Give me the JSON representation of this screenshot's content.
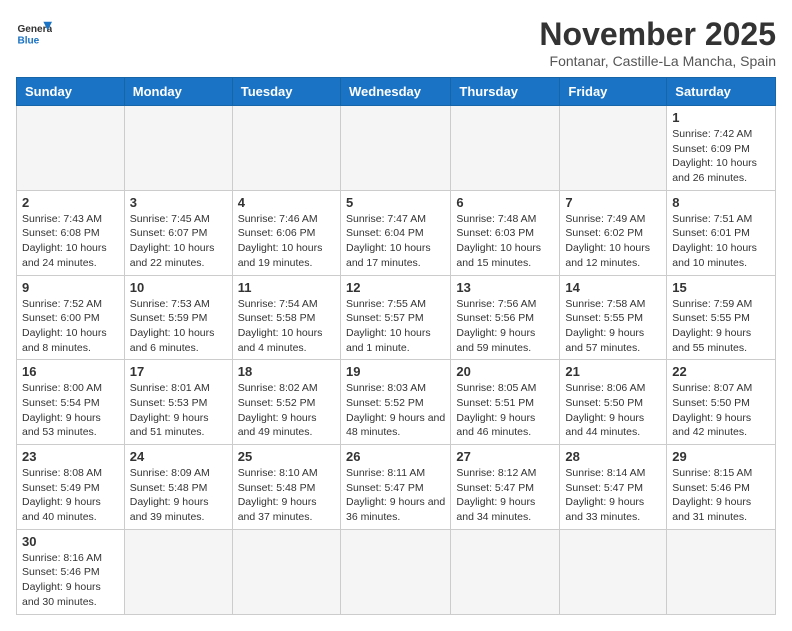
{
  "logo": {
    "text_general": "General",
    "text_blue": "Blue"
  },
  "header": {
    "month_title": "November 2025",
    "subtitle": "Fontanar, Castille-La Mancha, Spain"
  },
  "days_of_week": [
    "Sunday",
    "Monday",
    "Tuesday",
    "Wednesday",
    "Thursday",
    "Friday",
    "Saturday"
  ],
  "weeks": [
    [
      {
        "day": "",
        "info": ""
      },
      {
        "day": "",
        "info": ""
      },
      {
        "day": "",
        "info": ""
      },
      {
        "day": "",
        "info": ""
      },
      {
        "day": "",
        "info": ""
      },
      {
        "day": "",
        "info": ""
      },
      {
        "day": "1",
        "info": "Sunrise: 7:42 AM\nSunset: 6:09 PM\nDaylight: 10 hours and 26 minutes."
      }
    ],
    [
      {
        "day": "2",
        "info": "Sunrise: 7:43 AM\nSunset: 6:08 PM\nDaylight: 10 hours and 24 minutes."
      },
      {
        "day": "3",
        "info": "Sunrise: 7:45 AM\nSunset: 6:07 PM\nDaylight: 10 hours and 22 minutes."
      },
      {
        "day": "4",
        "info": "Sunrise: 7:46 AM\nSunset: 6:06 PM\nDaylight: 10 hours and 19 minutes."
      },
      {
        "day": "5",
        "info": "Sunrise: 7:47 AM\nSunset: 6:04 PM\nDaylight: 10 hours and 17 minutes."
      },
      {
        "day": "6",
        "info": "Sunrise: 7:48 AM\nSunset: 6:03 PM\nDaylight: 10 hours and 15 minutes."
      },
      {
        "day": "7",
        "info": "Sunrise: 7:49 AM\nSunset: 6:02 PM\nDaylight: 10 hours and 12 minutes."
      },
      {
        "day": "8",
        "info": "Sunrise: 7:51 AM\nSunset: 6:01 PM\nDaylight: 10 hours and 10 minutes."
      }
    ],
    [
      {
        "day": "9",
        "info": "Sunrise: 7:52 AM\nSunset: 6:00 PM\nDaylight: 10 hours and 8 minutes."
      },
      {
        "day": "10",
        "info": "Sunrise: 7:53 AM\nSunset: 5:59 PM\nDaylight: 10 hours and 6 minutes."
      },
      {
        "day": "11",
        "info": "Sunrise: 7:54 AM\nSunset: 5:58 PM\nDaylight: 10 hours and 4 minutes."
      },
      {
        "day": "12",
        "info": "Sunrise: 7:55 AM\nSunset: 5:57 PM\nDaylight: 10 hours and 1 minute."
      },
      {
        "day": "13",
        "info": "Sunrise: 7:56 AM\nSunset: 5:56 PM\nDaylight: 9 hours and 59 minutes."
      },
      {
        "day": "14",
        "info": "Sunrise: 7:58 AM\nSunset: 5:55 PM\nDaylight: 9 hours and 57 minutes."
      },
      {
        "day": "15",
        "info": "Sunrise: 7:59 AM\nSunset: 5:55 PM\nDaylight: 9 hours and 55 minutes."
      }
    ],
    [
      {
        "day": "16",
        "info": "Sunrise: 8:00 AM\nSunset: 5:54 PM\nDaylight: 9 hours and 53 minutes."
      },
      {
        "day": "17",
        "info": "Sunrise: 8:01 AM\nSunset: 5:53 PM\nDaylight: 9 hours and 51 minutes."
      },
      {
        "day": "18",
        "info": "Sunrise: 8:02 AM\nSunset: 5:52 PM\nDaylight: 9 hours and 49 minutes."
      },
      {
        "day": "19",
        "info": "Sunrise: 8:03 AM\nSunset: 5:52 PM\nDaylight: 9 hours and 48 minutes."
      },
      {
        "day": "20",
        "info": "Sunrise: 8:05 AM\nSunset: 5:51 PM\nDaylight: 9 hours and 46 minutes."
      },
      {
        "day": "21",
        "info": "Sunrise: 8:06 AM\nSunset: 5:50 PM\nDaylight: 9 hours and 44 minutes."
      },
      {
        "day": "22",
        "info": "Sunrise: 8:07 AM\nSunset: 5:50 PM\nDaylight: 9 hours and 42 minutes."
      }
    ],
    [
      {
        "day": "23",
        "info": "Sunrise: 8:08 AM\nSunset: 5:49 PM\nDaylight: 9 hours and 40 minutes."
      },
      {
        "day": "24",
        "info": "Sunrise: 8:09 AM\nSunset: 5:48 PM\nDaylight: 9 hours and 39 minutes."
      },
      {
        "day": "25",
        "info": "Sunrise: 8:10 AM\nSunset: 5:48 PM\nDaylight: 9 hours and 37 minutes."
      },
      {
        "day": "26",
        "info": "Sunrise: 8:11 AM\nSunset: 5:47 PM\nDaylight: 9 hours and 36 minutes."
      },
      {
        "day": "27",
        "info": "Sunrise: 8:12 AM\nSunset: 5:47 PM\nDaylight: 9 hours and 34 minutes."
      },
      {
        "day": "28",
        "info": "Sunrise: 8:14 AM\nSunset: 5:47 PM\nDaylight: 9 hours and 33 minutes."
      },
      {
        "day": "29",
        "info": "Sunrise: 8:15 AM\nSunset: 5:46 PM\nDaylight: 9 hours and 31 minutes."
      }
    ],
    [
      {
        "day": "30",
        "info": "Sunrise: 8:16 AM\nSunset: 5:46 PM\nDaylight: 9 hours and 30 minutes."
      },
      {
        "day": "",
        "info": ""
      },
      {
        "day": "",
        "info": ""
      },
      {
        "day": "",
        "info": ""
      },
      {
        "day": "",
        "info": ""
      },
      {
        "day": "",
        "info": ""
      },
      {
        "day": "",
        "info": ""
      }
    ]
  ]
}
